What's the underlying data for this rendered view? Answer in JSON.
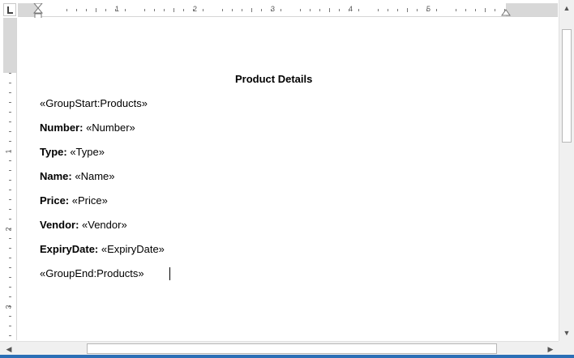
{
  "ruler": {
    "horizontal_numbers": [
      "1",
      "2",
      "3",
      "4",
      "5"
    ],
    "vertical_numbers": [
      "1",
      "2",
      "3"
    ]
  },
  "document": {
    "title": "Product Details",
    "lines": [
      {
        "label": "",
        "value": "«GroupStart:Products»"
      },
      {
        "label": "Number:",
        "value": " «Number»"
      },
      {
        "label": "Type:",
        "value": " «Type»"
      },
      {
        "label": "Name:",
        "value": " «Name»"
      },
      {
        "label": "Price:",
        "value": " «Price»"
      },
      {
        "label": "Vendor:",
        "value": " «Vendor»"
      },
      {
        "label": "ExpiryDate:",
        "value": " «ExpiryDate»"
      },
      {
        "label": "",
        "value": "«GroupEnd:Products»"
      }
    ]
  },
  "scrollbars": {
    "up_arrow": "▲",
    "down_arrow": "▼",
    "left_arrow": "◀",
    "right_arrow": "▶"
  },
  "colors": {
    "accent": "#2b6fb6"
  }
}
